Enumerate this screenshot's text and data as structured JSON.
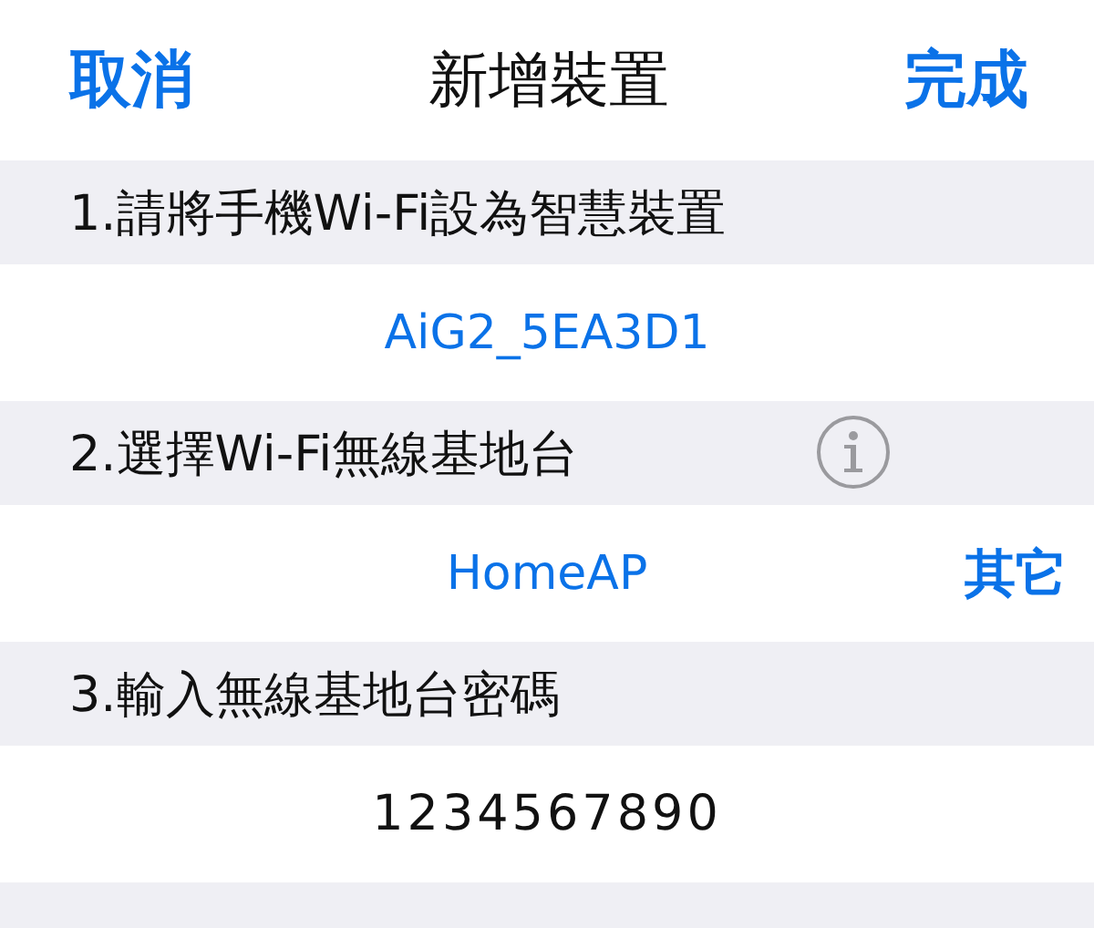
{
  "nav": {
    "cancel": "取消",
    "title": "新增裝置",
    "done": "完成"
  },
  "sections": [
    {
      "header": "1.請將手機Wi-Fi設為智慧裝置",
      "info": false,
      "kind": "value",
      "value": "AiG2_5EA3D1"
    },
    {
      "header": "2.選擇Wi-Fi無線基地台",
      "info": true,
      "kind": "picker",
      "value": "HomeAP",
      "action": "其它"
    },
    {
      "header": "3.輸入無線基地台密碼",
      "info": false,
      "kind": "input",
      "value": "1234567890"
    }
  ]
}
